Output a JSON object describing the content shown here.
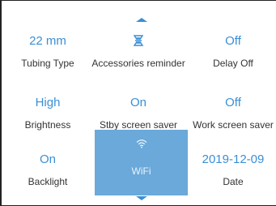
{
  "settings": [
    {
      "value": "22 mm",
      "label": "Tubing Type"
    },
    {
      "value": "",
      "label": "Accessories reminder",
      "icon": "accessories-icon"
    },
    {
      "value": "Off",
      "label": "Delay Off"
    },
    {
      "value": "High",
      "label": "Brightness"
    },
    {
      "value": "On",
      "label": "Stby screen saver"
    },
    {
      "value": "Off",
      "label": "Work screen saver"
    },
    {
      "value": "On",
      "label": "Backlight"
    },
    {
      "value": "",
      "label": "WiFi",
      "icon": "wifi-icon"
    },
    {
      "value": "2019-12-09",
      "label": "Date"
    }
  ],
  "colors": {
    "accent": "#3a8fd6",
    "selected_bg": "#6aa9d9"
  },
  "selected_item": "WiFi"
}
